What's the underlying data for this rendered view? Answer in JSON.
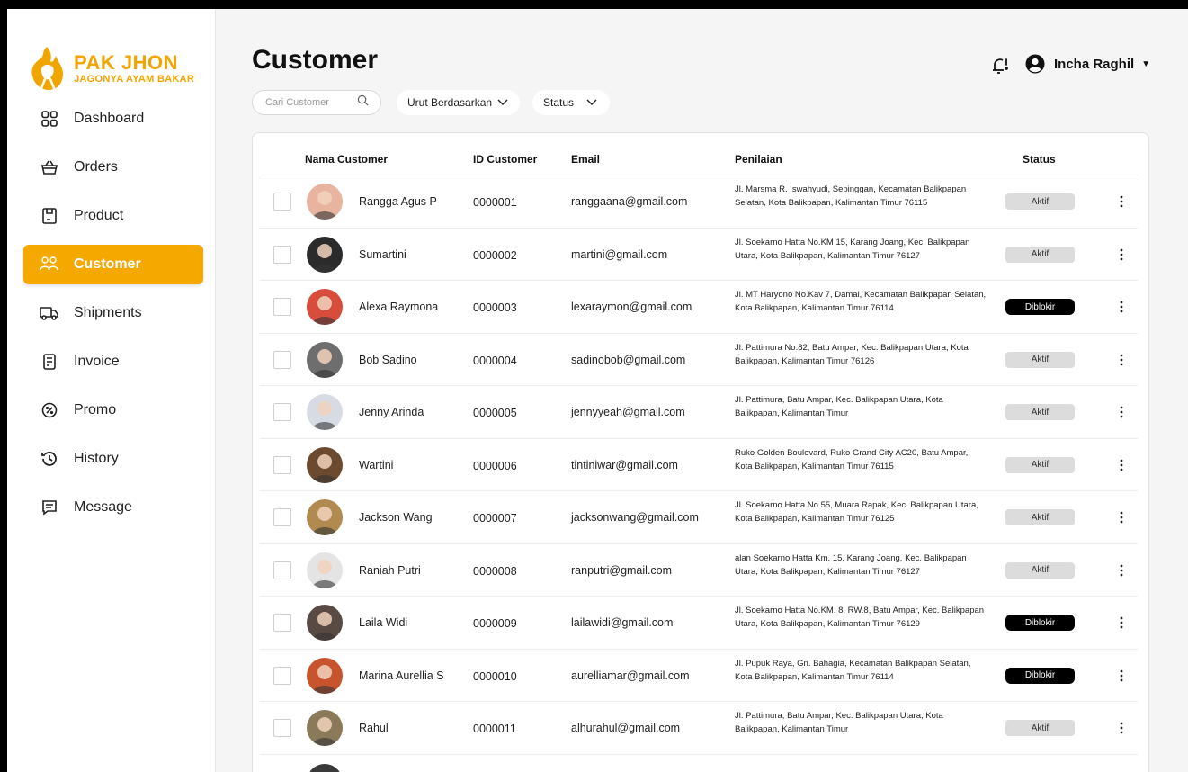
{
  "brand": {
    "title": "PAK JHON",
    "subtitle": "JAGONYA AYAM BAKAR",
    "color": "#f0a500"
  },
  "sidebar": {
    "items": [
      {
        "label": "Dashboard",
        "icon": "grid-icon"
      },
      {
        "label": "Orders",
        "icon": "basket-icon"
      },
      {
        "label": "Product",
        "icon": "box-icon"
      },
      {
        "label": "Customer",
        "icon": "users-icon",
        "active": true
      },
      {
        "label": "Shipments",
        "icon": "truck-icon"
      },
      {
        "label": "Invoice",
        "icon": "receipt-icon"
      },
      {
        "label": "Promo",
        "icon": "discount-icon"
      },
      {
        "label": "History",
        "icon": "history-icon"
      },
      {
        "label": "Message",
        "icon": "message-icon"
      }
    ],
    "active_color": "#f5a800"
  },
  "header": {
    "title": "Customer",
    "search_placeholder": "Cari Customer",
    "sort_label": "Urut Berdasarkan",
    "status_label": "Status",
    "user_name": "Incha Raghil"
  },
  "table": {
    "columns": [
      "Nama Customer",
      "ID Customer",
      "Email",
      "Penilaian",
      "Status"
    ],
    "rows": [
      {
        "name": "Rangga Agus P",
        "id": "0000001",
        "email": "ranggaana@gmail.com",
        "address": "Jl. Marsma R. Iswahyudi, Sepinggan, Kecamatan Balikpapan Selatan, Kota Balikpapan, Kalimantan Timur 76115",
        "status": "Aktif",
        "blocked": false,
        "avatar_color": "#e8b4a0"
      },
      {
        "name": "Sumartini",
        "id": "0000002",
        "email": "martini@gmail.com",
        "address": "Jl. Soekarno Hatta No.KM 15, Karang Joang, Kec. Balikpapan Utara, Kota Balikpapan, Kalimantan Timur 76127",
        "status": "Aktif",
        "blocked": false,
        "avatar_color": "#2b2b2b"
      },
      {
        "name": "Alexa Raymona",
        "id": "0000003",
        "email": "lexaraymon@gmail.com",
        "address": "Jl. MT Haryono No.Kav 7, Damai, Kecamatan Balikpapan Selatan, Kota Balikpapan, Kalimantan Timur 76114",
        "status": "Diblokir",
        "blocked": true,
        "avatar_color": "#d84c3c"
      },
      {
        "name": "Bob Sadino",
        "id": "0000004",
        "email": "sadinobob@gmail.com",
        "address": "Jl. Pattimura No.82, Batu Ampar, Kec. Balikpapan Utara, Kota Balikpapan, Kalimantan Timur 76126",
        "status": "Aktif",
        "blocked": false,
        "avatar_color": "#6e6e6e"
      },
      {
        "name": "Jenny Arinda",
        "id": "0000005",
        "email": "jennyyeah@gmail.com",
        "address": "Jl. Pattimura, Batu Ampar, Kec. Balikpapan Utara, Kota Balikpapan, Kalimantan Timur",
        "status": "Aktif",
        "blocked": false,
        "avatar_color": "#d6dbe4"
      },
      {
        "name": "Wartini",
        "id": "0000006",
        "email": "tintiniwar@gmail.com",
        "address": "Ruko Golden Boulevard, Ruko Grand City AC20, Batu Ampar, Kota Balikpapan, Kalimantan Timur 76115",
        "status": "Aktif",
        "blocked": false,
        "avatar_color": "#6b4a2f"
      },
      {
        "name": "Jackson Wang",
        "id": "0000007",
        "email": "jacksonwang@gmail.com",
        "address": "Jl. Soekarno Hatta No.55, Muara Rapak, Kec. Balikpapan Utara, Kota Balikpapan, Kalimantan Timur 76125",
        "status": "Aktif",
        "blocked": false,
        "avatar_color": "#b08a4f"
      },
      {
        "name": "Raniah Putri",
        "id": "0000008",
        "email": "ranputri@gmail.com",
        "address": "alan Soekarno Hatta Km. 15, Karang Joang, Kec. Balikpapan Utara, Kota Balikpapan, Kalimantan Timur 76127",
        "status": "Aktif",
        "blocked": false,
        "avatar_color": "#e4e4e4"
      },
      {
        "name": "Laila Widi",
        "id": "0000009",
        "email": "lailawidi@gmail.com",
        "address": "Jl. Soekarno Hatta No.KM. 8, RW.8, Batu Ampar, Kec. Balikpapan Utara, Kota Balikpapan, Kalimantan Timur 76129",
        "status": "Diblokir",
        "blocked": true,
        "avatar_color": "#5a4a44"
      },
      {
        "name": "Marina Aurellia S",
        "id": "0000010",
        "email": "aurelliamar@gmail.com",
        "address": "Jl. Pupuk Raya, Gn. Bahagia, Kecamatan Balikpapan Selatan, Kota Balikpapan, Kalimantan Timur 76114",
        "status": "Diblokir",
        "blocked": true,
        "avatar_color": "#c8542e"
      },
      {
        "name": "Rahul",
        "id": "0000011",
        "email": "alhurahul@gmail.com",
        "address": "Jl. Pattimura, Batu Ampar, Kec. Balikpapan Utara, Kota Balikpapan, Kalimantan Timur",
        "status": "Aktif",
        "blocked": false,
        "avatar_color": "#8a7a5a"
      }
    ]
  }
}
